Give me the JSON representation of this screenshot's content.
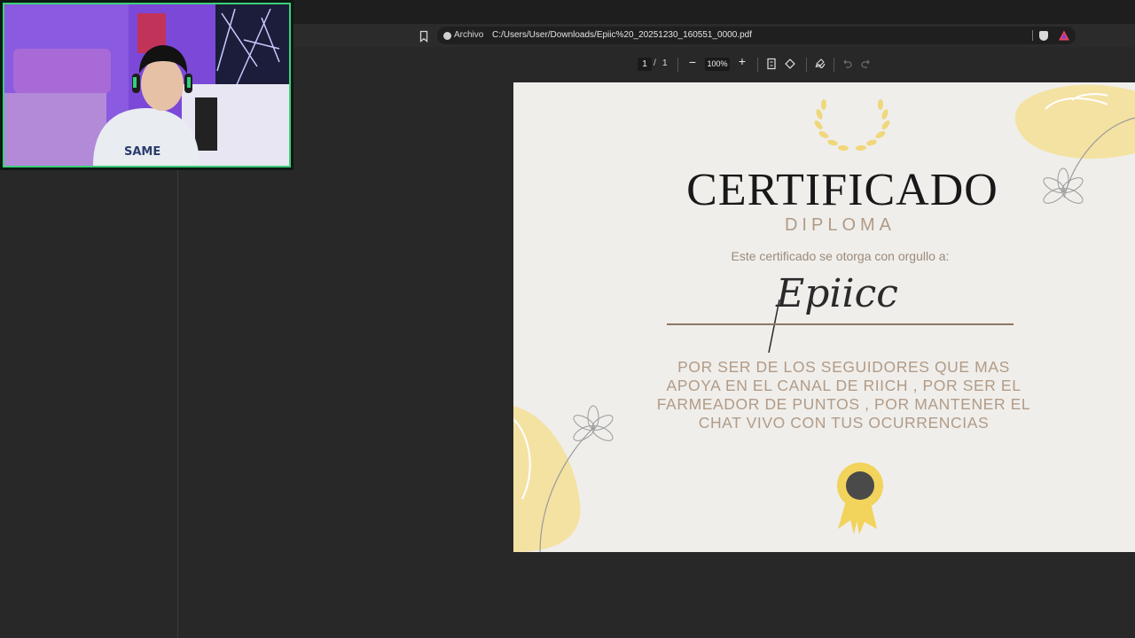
{
  "address_bar": {
    "site_info_label": "Archivo",
    "url": "C:/Users/User/Downloads/Epiic%20_20251230_160551_0000.pdf"
  },
  "pdf_toolbar": {
    "current_page": "1",
    "page_separator": "/",
    "total_pages": "1",
    "zoom_out_label": "−",
    "zoom_level": "100%",
    "zoom_in_label": "+"
  },
  "certificate": {
    "title": "CERTIFICADO",
    "subtitle": "DIPLOMA",
    "intro": "Este certificado se otorga con orgullo a:",
    "recipient": "Epiicc",
    "body_lines": [
      "POR SER DE LOS SEGUIDORES  QUE MAS",
      "APOYA EN EL CANAL DE RIICH , POR SER EL",
      "FARMEADOR DE PUNTOS , POR MANTENER EL",
      "CHAT VIVO CON TUS OCURRENCIAS"
    ]
  },
  "colors": {
    "title": "#181818",
    "accent_text": "#b09a84",
    "laurel": "#f0d77a",
    "webcam_border": "#3dcf7a"
  },
  "icons": [
    "bookmark-icon",
    "info-icon",
    "brave-shield-icon",
    "brave-rewards-icon",
    "fit-page-icon",
    "rotate-icon",
    "annotate-icon",
    "undo-icon",
    "redo-icon"
  ]
}
